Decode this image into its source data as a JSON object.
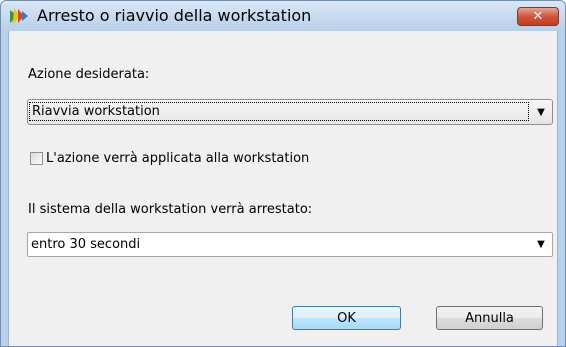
{
  "window": {
    "title": "Arresto o riavvio della workstation",
    "close_glyph": "✕",
    "app_icon": "avg-logo-icon"
  },
  "action": {
    "label": "Azione desiderata:",
    "selected": "Riavvia workstation"
  },
  "apply_checkbox": {
    "label": "L'azione verrà applicata alla workstation",
    "checked": false
  },
  "shutdown": {
    "label": "Il sistema della workstation verrà arrestato:",
    "selected": "entro 30 secondi"
  },
  "buttons": {
    "ok": "OK",
    "cancel": "Annulla"
  },
  "colors": {
    "title_bar": "#c4d8ee",
    "close_button": "#d1563c",
    "dialog_face": "#f0f0f0",
    "default_button": "#bee6fd"
  }
}
